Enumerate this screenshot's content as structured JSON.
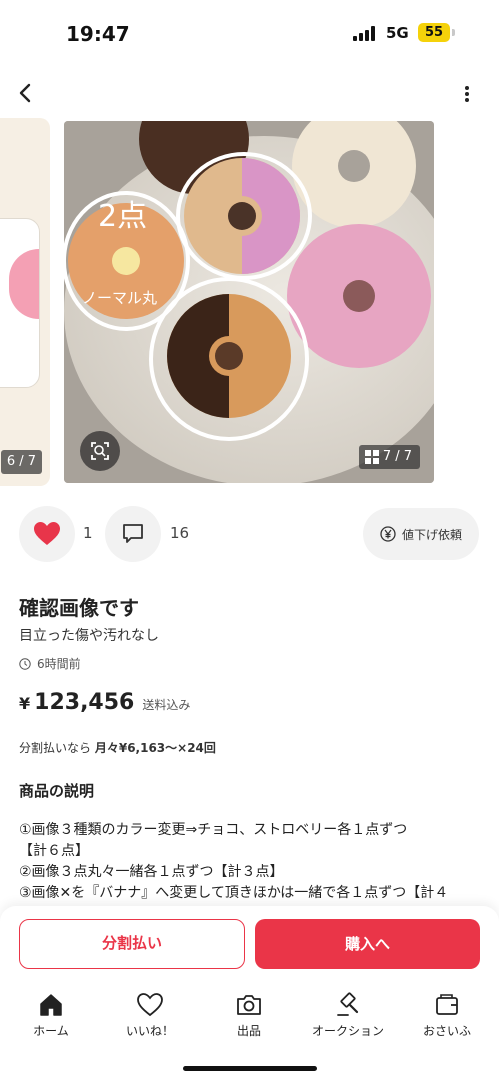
{
  "status": {
    "time": "19:47",
    "network": "5G",
    "battery": "55"
  },
  "gallery": {
    "prev_counter": "6 / 7",
    "main_counter": "7 / 7",
    "overlay_labels": [
      "2点",
      "ノーマル丸"
    ]
  },
  "actions": {
    "like_count": "1",
    "comment_count": "16",
    "price_request_label": "値下げ依頼"
  },
  "item": {
    "title": "確認画像です",
    "subtitle": "目立った傷や汚れなし",
    "time_ago": "6時間前",
    "price_symbol": "¥",
    "price": "123,456",
    "shipping": "送料込み",
    "installment_prefix": "分割払いなら",
    "installment_value": "月々¥6,163～×24回",
    "description_heading": "商品の説明",
    "description_lines": [
      "①画像３種類のカラー変更⇒チョコ、ストロベリー各１点ずつ",
      "【計６点】",
      "②画像３点丸々一緒各１点ずつ【計３点】",
      "③画像✕を『バナナ』へ変更して頂きほかは一緒で各１点ずつ【計４"
    ]
  },
  "buy_bar": {
    "split_label": "分割払い",
    "buy_label": "購入へ"
  },
  "tabs": [
    {
      "label": "ホーム",
      "icon": "home-icon"
    },
    {
      "label": "いいね！",
      "icon": "heart-icon"
    },
    {
      "label": "出品",
      "icon": "camera-icon"
    },
    {
      "label": "オークション",
      "icon": "gavel-icon"
    },
    {
      "label": "おさいふ",
      "icon": "wallet-icon"
    }
  ],
  "colors": {
    "accent": "#ea3548",
    "like": "#e8354a",
    "battery": "#f5d20a"
  }
}
